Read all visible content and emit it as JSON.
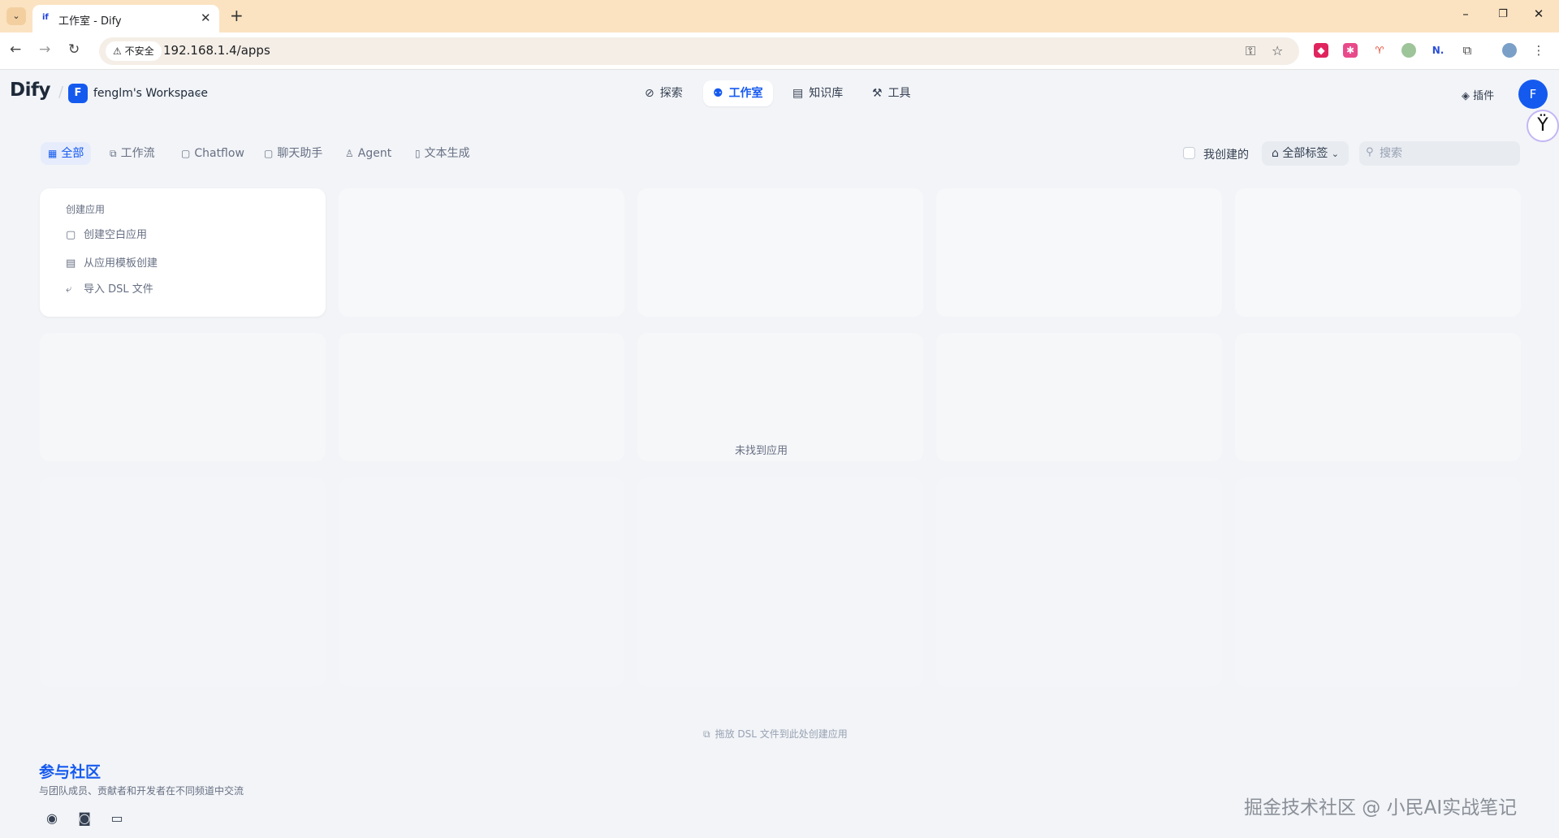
{
  "browser": {
    "tab_title": "工作室 - Dify",
    "tab_favicon": "if",
    "security_label": "不安全",
    "url": "192.168.1.4/apps"
  },
  "header": {
    "logo": "Dify",
    "workspace_initial": "F",
    "workspace_name": "fenglm's Workspace",
    "nav": [
      {
        "label": "探索",
        "icon": "compass-icon"
      },
      {
        "label": "工作室",
        "icon": "robot-icon",
        "active": true
      },
      {
        "label": "知识库",
        "icon": "book-icon"
      },
      {
        "label": "工具",
        "icon": "hammer-icon"
      }
    ],
    "plugin_label": "插件",
    "user_initial": "F"
  },
  "filters": {
    "tabs": [
      {
        "label": "全部",
        "icon": "grid-icon",
        "active": true
      },
      {
        "label": "工作流",
        "icon": "workflow-icon"
      },
      {
        "label": "Chatflow",
        "icon": "chatflow-icon"
      },
      {
        "label": "聊天助手",
        "icon": "chat-bubble-icon"
      },
      {
        "label": "Agent",
        "icon": "agent-icon"
      },
      {
        "label": "文本生成",
        "icon": "text-file-icon"
      }
    ],
    "mine_label": "我创建的",
    "tags_label": "全部标签",
    "search_placeholder": "搜索"
  },
  "create_card": {
    "title": "创建应用",
    "items": [
      {
        "label": "创建空白应用",
        "icon": "blank-file-icon"
      },
      {
        "label": "从应用模板创建",
        "icon": "template-icon"
      },
      {
        "label": "导入 DSL 文件",
        "icon": "import-icon"
      }
    ]
  },
  "empty_state": "未找到应用",
  "dsl_hint": "拖放 DSL 文件到此处创建应用",
  "community": {
    "title": "参与社区",
    "description": "与团队成员、贡献者和开发者在不同频道中交流",
    "links": [
      "github-icon",
      "discord-icon",
      "forum-icon"
    ]
  },
  "watermark": "掘金技术社区 @ 小民AI实战笔记"
}
